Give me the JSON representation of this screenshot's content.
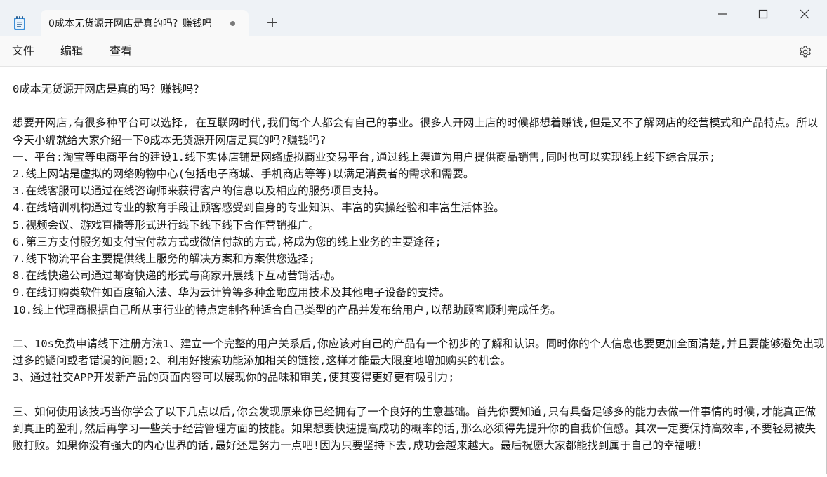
{
  "titlebar": {
    "app_icon": "notepad-icon",
    "tab_title": "0成本无货源开网店是真的吗？赚钱吗",
    "tab_state": "unsaved-dot",
    "new_tab_label": "+"
  },
  "window_controls": {
    "minimize_icon": "minimize-icon",
    "maximize_icon": "maximize-icon",
    "close_icon": "close-icon"
  },
  "menu": {
    "file": "文件",
    "edit": "编辑",
    "view": "查看",
    "settings_icon": "gear-icon"
  },
  "document": {
    "lines": [
      "0成本无货源开网店是真的吗？赚钱吗？",
      "",
      "想要开网店,有很多种平台可以选择, 在互联网时代,我们每个人都会有自己的事业。很多人开网上店的时候都想着赚钱,但是又不了解网店的经营模式和产品特点。所以今天小编就给大家介绍一下0成本无货源开网店是真的吗?赚钱吗?",
      "一、平台:淘宝等电商平台的建设1.线下实体店铺是网络虚拟商业交易平台,通过线上渠道为用户提供商品销售,同时也可以实现线上线下综合展示;",
      "2.线上网站是虚拟的网络购物中心(包括电子商城、手机商店等等)以满足消费者的需求和需要。",
      "3.在线客服可以通过在线咨询师来获得客户的信息以及相应的服务项目支持。",
      "4.在线培训机构通过专业的教育手段让顾客感受到自身的专业知识、丰富的实操经验和丰富生活体验。",
      "5.视频会议、游戏直播等形式进行线下线下线下合作营销推广。",
      "6.第三方支付服务如支付宝付款方式或微信付款的方式,将成为您的线上业务的主要途径;",
      "7.线下物流平台主要提供线上服务的解决方案和方案供您选择;",
      "8.在线快递公司通过邮寄快递的形式与商家开展线下互动营销活动。",
      "9.在线订购类软件如百度输入法、华为云计算等多种金融应用技术及其他电子设备的支持。",
      "10.线上代理商根据自己所从事行业的特点定制各种适合自己类型的产品并发布给用户,以帮助顾客顺利完成任务。",
      "",
      "二、10s免费申请线下注册方法1、建立一个完整的用户关系后,你应该对自己的产品有一个初步的了解和认识。同时你的个人信息也要更加全面清楚,并且要能够避免出现过多的疑问或者错误的问题;2、利用好搜索功能添加相关的链接,这样才能最大限度地增加购买的机会。",
      "3、通过社交APP开发新产品的页面内容可以展现你的品味和审美,使其变得更好更有吸引力;",
      "",
      "三、如何使用该技巧当你学会了以下几点以后,你会发现原来你已经拥有了一个良好的生意基础。首先你要知道,只有具备足够多的能力去做一件事情的时候,才能真正做到真正的盈利,然后再学习一些关于经营管理方面的技能。如果想要快速提高成功的概率的话,那么必须得先提升你的自我价值感。其次一定要保持高效率,不要轻易被失败打败。如果你没有强大的内心世界的话,最好还是努力一点吧!因为只要坚持下去,成功会越来越大。最后祝愿大家都能找到属于自己的幸福哦!"
    ]
  }
}
